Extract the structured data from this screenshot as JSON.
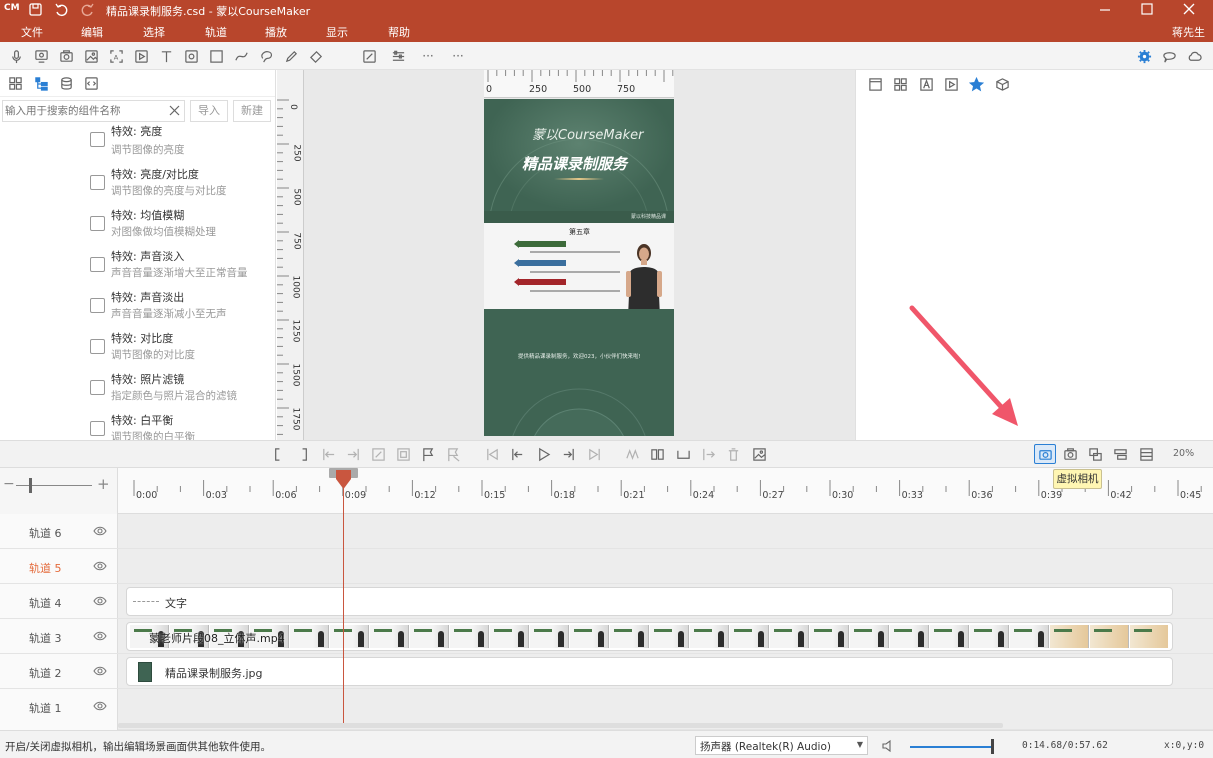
{
  "window": {
    "logo": "CM",
    "title": "精品课录制服务.csd - 蒙以CourseMaker",
    "user": "蒋先生"
  },
  "menu": [
    "文件",
    "编辑",
    "选择",
    "轨道",
    "播放",
    "显示",
    "帮助"
  ],
  "toolbar_icons": [
    "microphone-icon",
    "webcam-icon",
    "camera-icon",
    "image-icon",
    "screen-capture-icon",
    "video-icon",
    "text-icon",
    "media-icon",
    "rectangle-icon",
    "curve-icon",
    "lasso-icon",
    "pen-icon",
    "eraser-icon",
    "crop-icon",
    "adjust-icon",
    "more-icon",
    "more-icon-2"
  ],
  "left_panel": {
    "search_placeholder": "输入用于搜索的组件名称",
    "import_label": "导入",
    "new_label": "新建",
    "items": [
      {
        "title": "特效: 亮度",
        "desc": "调节图像的亮度"
      },
      {
        "title": "特效: 亮度/对比度",
        "desc": "调节图像的亮度与对比度"
      },
      {
        "title": "特效: 均值模糊",
        "desc": "对图像做均值模糊处理"
      },
      {
        "title": "特效: 声音淡入",
        "desc": "声音音量逐渐增大至正常音量"
      },
      {
        "title": "特效: 声音淡出",
        "desc": "声音音量逐渐减小至无声"
      },
      {
        "title": "特效: 对比度",
        "desc": "调节图像的对比度"
      },
      {
        "title": "特效: 照片滤镜",
        "desc": "指定颜色与照片混合的滤镜"
      },
      {
        "title": "特效: 白平衡",
        "desc": "调节图像的白平衡"
      }
    ]
  },
  "rulers": {
    "horizontal": [
      "0",
      "250",
      "500",
      "750"
    ],
    "vertical": [
      "0",
      "250",
      "500",
      "750",
      "1000",
      "1250",
      "1500",
      "1750"
    ]
  },
  "preview": {
    "brand": "蒙以CourseMaker",
    "headline": "精品课录制服务",
    "small_tag": "蒙以科技精品课",
    "slide_title": "第五章",
    "footer_text": "提供精品课录制服务，欢迎023，小伙伴们快来啦!"
  },
  "playbar": {
    "tooltip": "虚拟相机",
    "zoom": "20%"
  },
  "timeline": {
    "ticks": [
      "0:00",
      "0:03",
      "0:06",
      "0:09",
      "0:12",
      "0:15",
      "0:18",
      "0:21",
      "0:24",
      "0:27",
      "0:30",
      "0:33",
      "0:36",
      "0:39",
      "0:42",
      "0:45"
    ],
    "playhead_time_fraction": 0.3,
    "tracks": [
      {
        "name": "轨道 6",
        "clip": null,
        "color": "#555555"
      },
      {
        "name": "轨道 5",
        "clip": null,
        "color": "#e46a3a"
      },
      {
        "name": "轨道 4",
        "clip": "文字",
        "color": "#555555"
      },
      {
        "name": "轨道 3",
        "clip": "蒙老师片段08_立体声.mp4",
        "color": "#555555"
      },
      {
        "name": "轨道 2",
        "clip": "精品课录制服务.jpg",
        "color": "#555555"
      },
      {
        "name": "轨道 1",
        "clip": null,
        "color": "#555555"
      }
    ]
  },
  "status": {
    "message": "开启/关闭虚拟相机，输出编辑场景画面供其他软件使用。",
    "audio_device": "扬声器 (Realtek(R) Audio)",
    "time": "0:14.68/0:57.62",
    "coords": "x:0,y:0",
    "volume_fraction": 1.0
  },
  "colors": {
    "accent": "#b8462c",
    "playhead": "#c9563f",
    "arrow": "#f0566a",
    "tooltip_bg": "#fff6b3"
  }
}
